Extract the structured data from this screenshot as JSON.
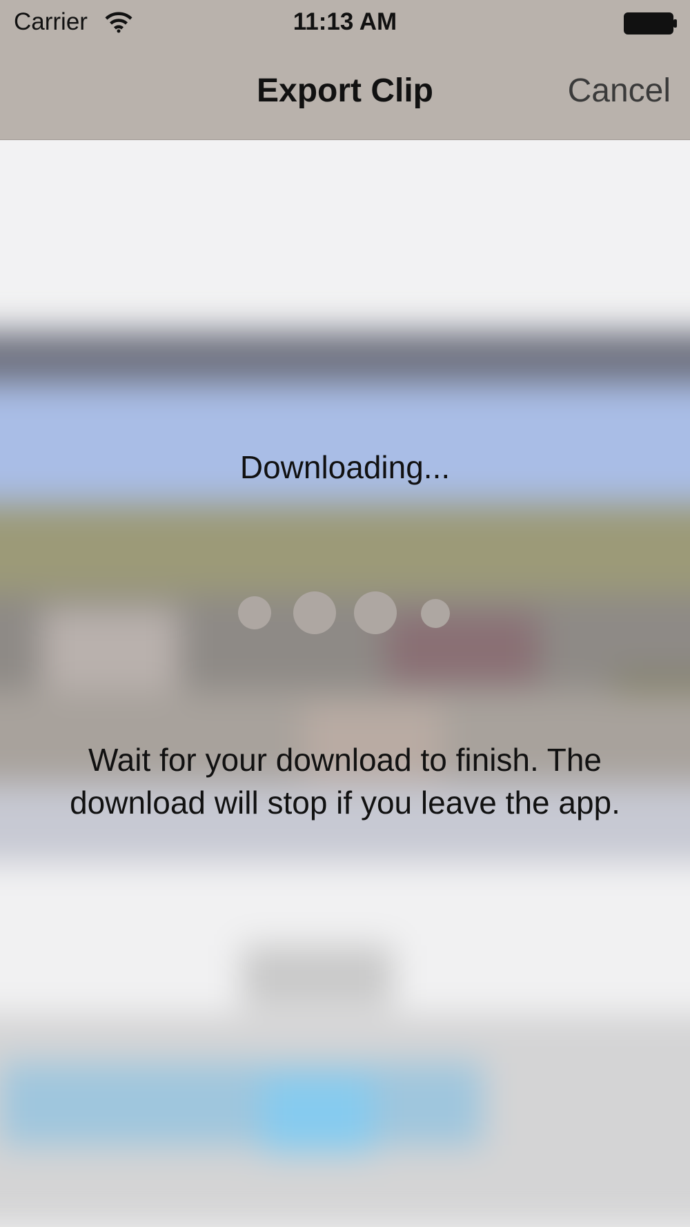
{
  "status_bar": {
    "carrier": "Carrier",
    "time": "11:13 AM",
    "wifi_icon": "wifi-icon",
    "battery_icon": "battery-icon"
  },
  "nav": {
    "title": "Export Clip",
    "cancel_label": "Cancel"
  },
  "download": {
    "status": "Downloading...",
    "message": "Wait for your download to finish. The download will stop if you leave the app."
  },
  "colors": {
    "nav_background": "#b9b2ac",
    "dot_color": "#aea7a2",
    "screen_background": "#f2f2f3"
  }
}
